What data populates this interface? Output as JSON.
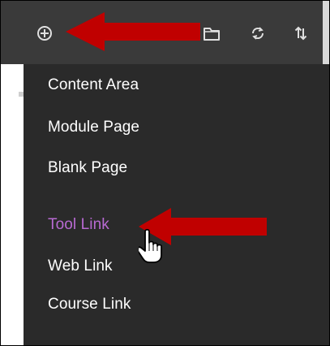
{
  "toolbar": {
    "icons": [
      {
        "name": "add-circle-icon"
      },
      {
        "name": "folder-icon"
      },
      {
        "name": "refresh-icon"
      },
      {
        "name": "sort-icon"
      }
    ]
  },
  "menu": {
    "items": [
      {
        "label": "Content Area",
        "state": "normal"
      },
      {
        "label": "Module Page",
        "state": "normal"
      },
      {
        "label": "Blank Page",
        "state": "normal"
      },
      {
        "label": "Tool Link",
        "state": "hover"
      },
      {
        "label": "Web Link",
        "state": "normal"
      },
      {
        "label": "Course Link",
        "state": "normal"
      }
    ]
  },
  "annotations": {
    "arrow_color": "#c00000",
    "hover_color": "#b86ad3"
  }
}
